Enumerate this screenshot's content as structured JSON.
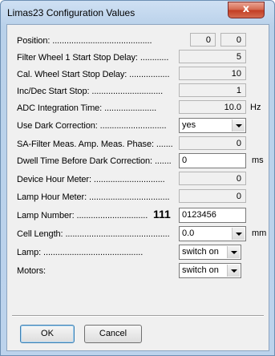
{
  "window": {
    "title": "Limas23 Configuration Values",
    "close_glyph": "x"
  },
  "fields": {
    "position": {
      "label": "Position: ..........................................",
      "value1": "0",
      "value2": "0"
    },
    "filter_wheel": {
      "label": "Filter Wheel 1 Start Stop Delay: ............",
      "value": "5"
    },
    "cal_wheel": {
      "label": "Cal. Wheel Start Stop Delay: .................",
      "value": "10"
    },
    "inc_dec": {
      "label": "Inc/Dec Start Stop: ..............................",
      "value": "1"
    },
    "adc": {
      "label": "ADC Integration Time: ......................",
      "value": "10.0",
      "unit": "Hz"
    },
    "dark_correction": {
      "label": "Use Dark Correction: ............................",
      "value": "yes"
    },
    "sa_filter": {
      "label": "SA-Filter Meas. Amp. Meas. Phase: .......",
      "value": "0"
    },
    "dwell_time": {
      "label": "Dwell Time Before Dark Correction: .......",
      "value": "0",
      "unit": "ms"
    },
    "device_hour": {
      "label": "Device Hour Meter: ..............................",
      "value": "0"
    },
    "lamp_hour": {
      "label": "Lamp Hour Meter: ..................................",
      "value": "0"
    },
    "lamp_number": {
      "label": "Lamp Number: ..............................",
      "prefix": "111",
      "value": "0123456"
    },
    "cell_length": {
      "label": "Cell Length: ............................................",
      "value": "0.0",
      "unit": "mm"
    },
    "lamp": {
      "label": "Lamp: ..........................................",
      "value": "switch on"
    },
    "motors": {
      "label": "Motors:",
      "value": "switch on"
    }
  },
  "buttons": {
    "ok": "OK",
    "cancel": "Cancel"
  }
}
